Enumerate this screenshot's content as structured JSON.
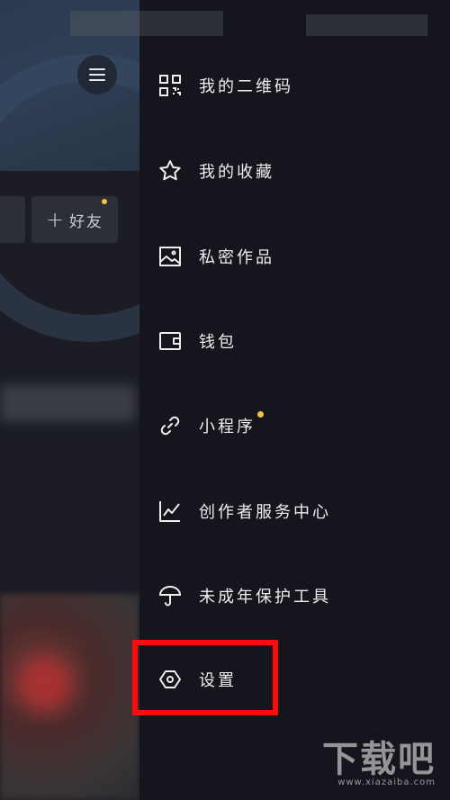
{
  "left_pane": {
    "add_friend_label": "好友",
    "add_friend_icon": "plus"
  },
  "drawer": {
    "items": [
      {
        "icon": "qr-code-icon",
        "label": "我的二维码"
      },
      {
        "icon": "star-icon",
        "label": "我的收藏"
      },
      {
        "icon": "image-icon",
        "label": "私密作品"
      },
      {
        "icon": "wallet-icon",
        "label": "钱包"
      },
      {
        "icon": "link-icon",
        "label": "小程序",
        "badge": true
      },
      {
        "icon": "chart-icon",
        "label": "创作者服务中心"
      },
      {
        "icon": "umbrella-icon",
        "label": "未成年保护工具"
      },
      {
        "icon": "hexagon-settings-icon",
        "label": "设置",
        "highlighted": true
      }
    ]
  },
  "watermark": {
    "brand": "下载吧",
    "domain": "www.xiazaiba.com"
  },
  "colors": {
    "badge": "#f5c542",
    "highlight": "#ff0b0b",
    "drawer_bg": "#15161d"
  }
}
